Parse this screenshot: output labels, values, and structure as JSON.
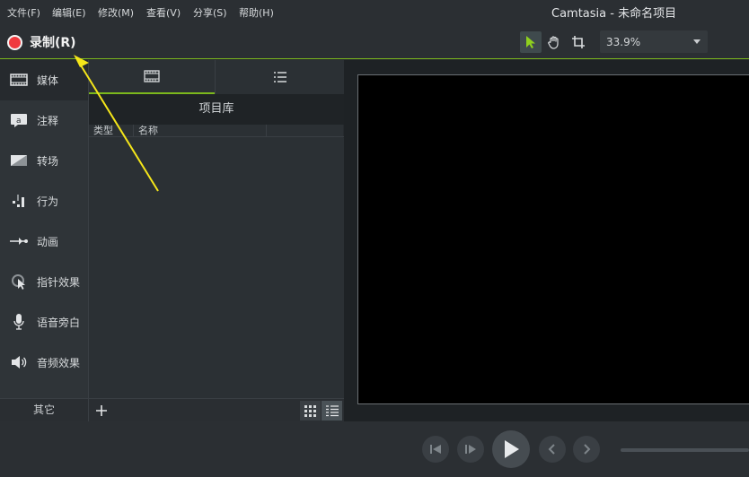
{
  "menu": {
    "items": [
      "文件(F)",
      "编辑(E)",
      "修改(M)",
      "查看(V)",
      "分享(S)",
      "帮助(H)"
    ]
  },
  "app_title": "Camtasia - 未命名项目",
  "toolbar": {
    "record_label": "录制(R)",
    "tools": [
      "select-icon",
      "pan-icon",
      "crop-icon"
    ],
    "zoom_value": "33.9%"
  },
  "sidebar": {
    "items": [
      {
        "label": "媒体",
        "icon": "film-icon"
      },
      {
        "label": "注释",
        "icon": "annotation-icon"
      },
      {
        "label": "转场",
        "icon": "transition-icon"
      },
      {
        "label": "行为",
        "icon": "behavior-icon"
      },
      {
        "label": "动画",
        "icon": "animation-icon"
      },
      {
        "label": "指针效果",
        "icon": "cursor-effect-icon"
      },
      {
        "label": "语音旁白",
        "icon": "microphone-icon"
      },
      {
        "label": "音频效果",
        "icon": "speaker-icon"
      }
    ],
    "more_label": "其它"
  },
  "bin": {
    "header": "项目库",
    "columns": [
      "类型",
      "名称"
    ]
  },
  "colors": {
    "accent": "#7cb81c",
    "record": "#f0393e",
    "annotation_arrow": "#f5e61a"
  }
}
